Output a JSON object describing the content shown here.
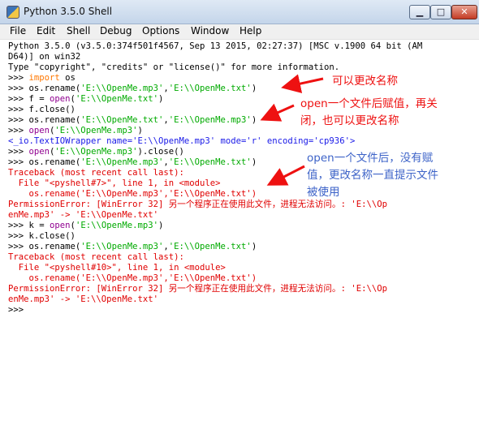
{
  "window": {
    "title": "Python 3.5.0 Shell"
  },
  "titlebar_buttons": {
    "minimize": "▁",
    "maximize": "□",
    "close": "✕"
  },
  "menu": [
    "File",
    "Edit",
    "Shell",
    "Debug",
    "Options",
    "Window",
    "Help"
  ],
  "shell": {
    "lines": [
      [
        {
          "t": "Python 3.5.0 (v3.5.0:374f501f4567, Sep 13 2015, 02:27:37) [MSC v.1900 64 bit (AM"
        }
      ],
      [
        {
          "t": "D64)] on win32"
        }
      ],
      [
        {
          "t": "Type \"copyright\", \"credits\" or \"license()\" for more information."
        }
      ],
      [
        {
          "t": ">>> "
        },
        {
          "t": "import",
          "c": "kw"
        },
        {
          "t": " os"
        }
      ],
      [
        {
          "t": ">>> os.rename("
        },
        {
          "t": "'E:\\\\OpenMe.mp3'",
          "c": "grn"
        },
        {
          "t": ","
        },
        {
          "t": "'E:\\\\OpenMe.txt'",
          "c": "grn"
        },
        {
          "t": ")"
        }
      ],
      [
        {
          "t": ">>> f = "
        },
        {
          "t": "open",
          "c": "bi"
        },
        {
          "t": "("
        },
        {
          "t": "'E:\\\\OpenMe.txt'",
          "c": "grn"
        },
        {
          "t": ")"
        }
      ],
      [
        {
          "t": ">>> f.close()"
        }
      ],
      [
        {
          "t": ">>> os.rename("
        },
        {
          "t": "'E:\\\\OpenMe.txt'",
          "c": "grn"
        },
        {
          "t": ","
        },
        {
          "t": "'E:\\\\OpenMe.mp3'",
          "c": "grn"
        },
        {
          "t": ")"
        }
      ],
      [
        {
          "t": ">>> "
        },
        {
          "t": "open",
          "c": "bi"
        },
        {
          "t": "("
        },
        {
          "t": "'E:\\\\OpenMe.mp3'",
          "c": "grn"
        },
        {
          "t": ")"
        }
      ],
      [
        {
          "t": "<_io.TextIOWrapper name='E:\\\\OpenMe.mp3' mode='r' encoding='cp936'>",
          "c": "blu"
        }
      ],
      [
        {
          "t": ">>> "
        },
        {
          "t": "open",
          "c": "bi"
        },
        {
          "t": "("
        },
        {
          "t": "'E:\\\\OpenMe.mp3'",
          "c": "grn"
        },
        {
          "t": ").close()"
        }
      ],
      [
        {
          "t": ">>> os.rename("
        },
        {
          "t": "'E:\\\\OpenMe.mp3'",
          "c": "grn"
        },
        {
          "t": ","
        },
        {
          "t": "'E:\\\\OpenMe.txt'",
          "c": "grn"
        },
        {
          "t": ")"
        }
      ],
      [
        {
          "t": "Traceback (most recent call last):",
          "c": "red"
        }
      ],
      [
        {
          "t": "  File \"<pyshell#7>\", line 1, in <module>",
          "c": "red"
        }
      ],
      [
        {
          "t": "    os.rename('E:\\\\OpenMe.mp3','E:\\\\OpenMe.txt')",
          "c": "red"
        }
      ],
      [
        {
          "t": "PermissionError: [WinError 32] 另一个程序正在使用此文件，进程无法访问。: 'E:\\\\Op",
          "c": "red"
        }
      ],
      [
        {
          "t": "enMe.mp3' -> 'E:\\\\OpenMe.txt'",
          "c": "red"
        }
      ],
      [
        {
          "t": ">>> k = "
        },
        {
          "t": "open",
          "c": "bi"
        },
        {
          "t": "("
        },
        {
          "t": "'E:\\\\OpenMe.mp3'",
          "c": "grn"
        },
        {
          "t": ")"
        }
      ],
      [
        {
          "t": ">>> k.close()"
        }
      ],
      [
        {
          "t": ">>> os.rename("
        },
        {
          "t": "'E:\\\\OpenMe.mp3'",
          "c": "grn"
        },
        {
          "t": ","
        },
        {
          "t": "'E:\\\\OpenMe.txt'",
          "c": "grn"
        },
        {
          "t": ")"
        }
      ],
      [
        {
          "t": "Traceback (most recent call last):",
          "c": "red"
        }
      ],
      [
        {
          "t": "  File \"<pyshell#10>\", line 1, in <module>",
          "c": "red"
        }
      ],
      [
        {
          "t": "    os.rename('E:\\\\OpenMe.mp3','E:\\\\OpenMe.txt')",
          "c": "red"
        }
      ],
      [
        {
          "t": "PermissionError: [WinError 32] 另一个程序正在使用此文件，进程无法访问。: 'E:\\\\Op",
          "c": "red"
        }
      ],
      [
        {
          "t": "enMe.mp3' -> 'E:\\\\OpenMe.txt'",
          "c": "red"
        }
      ],
      [
        {
          "t": ">>> "
        }
      ]
    ]
  },
  "annotations": {
    "note1": "可以更改名称",
    "note2_l1": "open一个文件后赋值，再关",
    "note2_l2": "闭，也可以更改名称",
    "note3_l1": "open一个文件后，没有赋",
    "note3_l2": "值，更改名称一直提示文件",
    "note3_l3": "被使用"
  },
  "colors": {
    "arrow_red": "#ee1111",
    "note_blue": "#3d63c8",
    "string_green": "#00aa00",
    "error_red": "#e00000"
  }
}
